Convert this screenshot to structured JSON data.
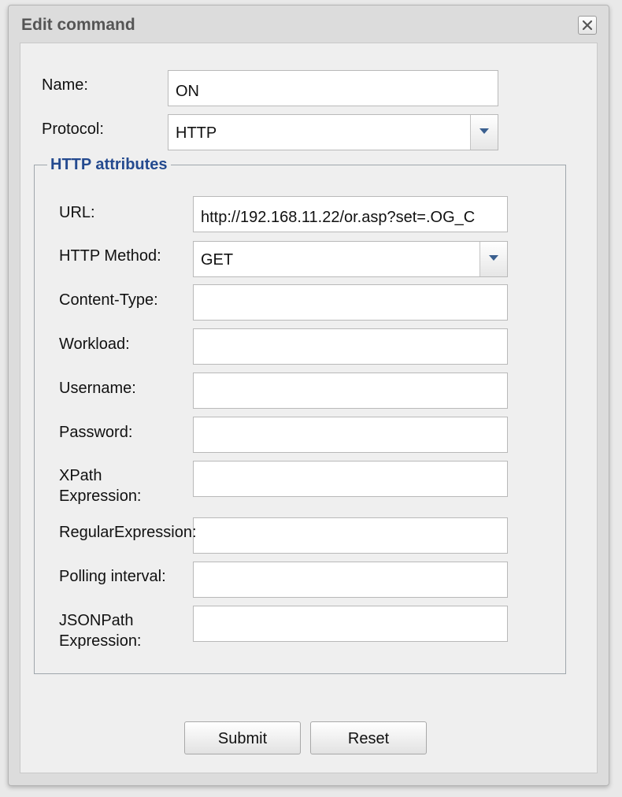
{
  "dialog": {
    "title": "Edit command",
    "close_icon": "close-icon"
  },
  "form": {
    "name_label": "Name:",
    "name_value": "ON",
    "protocol_label": "Protocol:",
    "protocol_value": "HTTP"
  },
  "http": {
    "legend": "HTTP attributes",
    "url_label": "URL:",
    "url_value": "http://192.168.11.22/or.asp?set=.OG_C",
    "method_label": "HTTP Method:",
    "method_value": "GET",
    "content_type_label": "Content-Type:",
    "content_type_value": "",
    "workload_label": "Workload:",
    "workload_value": "",
    "username_label": "Username:",
    "username_value": "",
    "password_label": "Password:",
    "password_value": "",
    "xpath_label_line1": "XPath",
    "xpath_label_line2": "Expression:",
    "xpath_value": "",
    "regex_label": "RegularExpression:",
    "regex_value": "",
    "polling_label": "Polling interval:",
    "polling_value": "",
    "jsonpath_label_line1": "JSONPath",
    "jsonpath_label_line2": "Expression:",
    "jsonpath_value": ""
  },
  "buttons": {
    "submit": "Submit",
    "reset": "Reset"
  },
  "icons": {
    "select_arrow": "chevron-down-icon"
  },
  "colors": {
    "legend": "#244a8f",
    "arrow": "#3a5f8f"
  }
}
